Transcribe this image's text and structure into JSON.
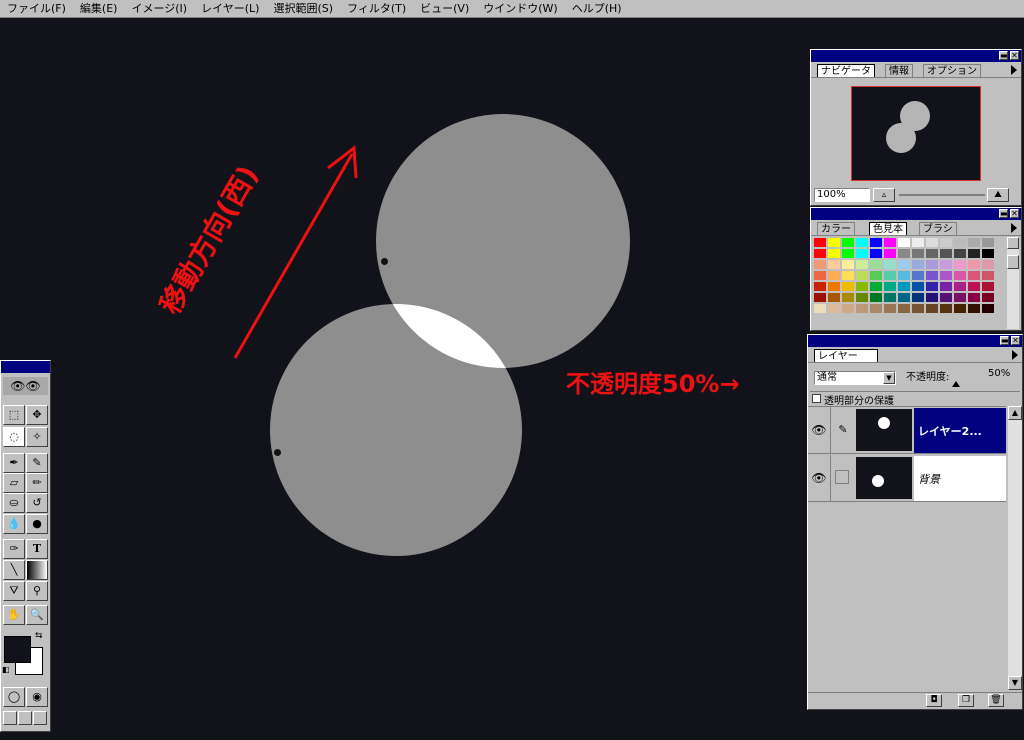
{
  "menu": {
    "items": [
      "ファイル(F)",
      "編集(E)",
      "イメージ(I)",
      "レイヤー(L)",
      "選択範囲(S)",
      "フィルタ(T)",
      "ビュー(V)",
      "ウインドウ(W)",
      "ヘルプ(H)"
    ]
  },
  "annotations": {
    "direction": "移動方向(西)",
    "opacity_note": "不透明度50%→"
  },
  "navigator": {
    "tabs": [
      "ナビゲータ",
      "情報",
      "オプション"
    ],
    "zoom": "100%"
  },
  "swatches": {
    "tabs": [
      "カラー",
      "色見本",
      "ブラシ"
    ],
    "colors": [
      "#ff0000",
      "#ffff00",
      "#00ff00",
      "#00ffff",
      "#0000ff",
      "#ff00ff",
      "#ffffff",
      "#eeeeee",
      "#dddddd",
      "#cccccc",
      "#bbbbbb",
      "#aaaaaa",
      "#999999",
      "#ff0000",
      "#ffff00",
      "#00ff00",
      "#00ffff",
      "#0000ff",
      "#ff00ff",
      "#888888",
      "#777777",
      "#666666",
      "#555555",
      "#444444",
      "#222222",
      "#000000",
      "#ee9977",
      "#ffcc99",
      "#ffee99",
      "#ccee99",
      "#99dd99",
      "#99ddcc",
      "#99ccee",
      "#99aadd",
      "#aa99dd",
      "#cc99dd",
      "#ee99cc",
      "#ee99aa",
      "#dd99aa",
      "#ee6644",
      "#ffaa55",
      "#ffdd55",
      "#bbdd55",
      "#55cc55",
      "#55ccaa",
      "#55bbdd",
      "#5577cc",
      "#7755cc",
      "#aa55cc",
      "#dd55aa",
      "#dd5577",
      "#cc5566",
      "#cc2200",
      "#ee7700",
      "#eebb00",
      "#88bb00",
      "#00aa33",
      "#00aa88",
      "#0099bb",
      "#0055aa",
      "#3322aa",
      "#7722aa",
      "#aa2288",
      "#bb1155",
      "#aa1133",
      "#991100",
      "#aa5500",
      "#aa8800",
      "#668800",
      "#007722",
      "#007766",
      "#006688",
      "#003377",
      "#221177",
      "#551177",
      "#771166",
      "#880044",
      "#770022",
      "#eeddbb",
      "#ddbb99",
      "#ccaa88",
      "#bb9977",
      "#aa8866",
      "#997755",
      "#886644",
      "#775533",
      "#664422",
      "#553311",
      "#442200",
      "#331100",
      "#220000"
    ]
  },
  "layers": {
    "tab": "レイヤー",
    "blend_mode": "通常",
    "opacity_label": "不透明度:",
    "opacity_value": "50%",
    "preserve_label": "透明部分の保護",
    "rows": [
      {
        "name": "レイヤー2...",
        "selected": true
      },
      {
        "name": "背景",
        "selected": false
      }
    ]
  },
  "toolbox": {
    "type_label": "T"
  },
  "colors": {
    "title_bar": "#000080",
    "annotation": "#ee1111",
    "canvas": "#11121a",
    "moon": "#8e8e8e",
    "overlap": "#ffffff"
  }
}
